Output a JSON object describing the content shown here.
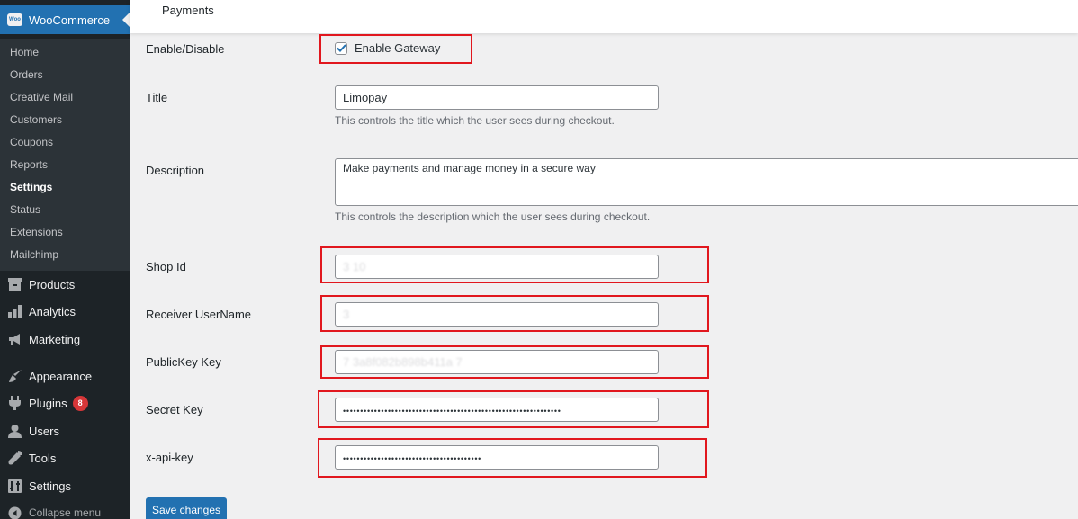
{
  "sidebar": {
    "brand": "WooCommerce",
    "brand_logo_text": "Woo",
    "submenu": [
      {
        "label": "Home"
      },
      {
        "label": "Orders"
      },
      {
        "label": "Creative Mail"
      },
      {
        "label": "Customers"
      },
      {
        "label": "Coupons"
      },
      {
        "label": "Reports"
      },
      {
        "label": "Settings",
        "active": true
      },
      {
        "label": "Status"
      },
      {
        "label": "Extensions"
      },
      {
        "label": "Mailchimp"
      }
    ],
    "menu": [
      {
        "label": "Products",
        "icon": "archive-icon"
      },
      {
        "label": "Analytics",
        "icon": "bar-chart-icon"
      },
      {
        "label": "Marketing",
        "icon": "megaphone-icon"
      },
      {
        "label": "Appearance",
        "icon": "paintbrush-icon"
      },
      {
        "label": "Plugins",
        "icon": "plug-icon",
        "badge": "8"
      },
      {
        "label": "Users",
        "icon": "user-icon"
      },
      {
        "label": "Tools",
        "icon": "wrench-icon"
      },
      {
        "label": "Settings",
        "icon": "settings-sliders-icon"
      },
      {
        "label": "Collapse menu",
        "icon": "collapse-arrow-icon"
      }
    ]
  },
  "topbar": {
    "tab": "Payments"
  },
  "form": {
    "enable": {
      "label": "Enable/Disable",
      "checkbox_label": "Enable Gateway",
      "checked": true
    },
    "title": {
      "label": "Title",
      "value": "Limopay",
      "description": "This controls the title which the user sees during checkout."
    },
    "description": {
      "label": "Description",
      "value": "Make payments and manage money in a secure way",
      "description": "This controls the description which the user sees during checkout."
    },
    "shop_id": {
      "label": "Shop Id",
      "value": "3      10"
    },
    "receiver": {
      "label": "Receiver UserName",
      "value": "      3"
    },
    "public_key": {
      "label": "PublicKey Key",
      "value": "        7  3a8f082b898b411a   7"
    },
    "secret_key": {
      "label": "Secret Key",
      "value": "•••••••••••••••••••••••••••••••••••••••••••••••••••••••••••••••"
    },
    "x_api_key": {
      "label": "x-api-key",
      "value": "••••••••••••••••••••••••••••••••••••••••"
    },
    "save_label": "Save changes"
  },
  "colors": {
    "sidebar_bg": "#1d2327",
    "submenu_bg": "#2c3338",
    "accent": "#2271b1",
    "highlight_box": "#e1171e",
    "badge": "#d63638"
  }
}
